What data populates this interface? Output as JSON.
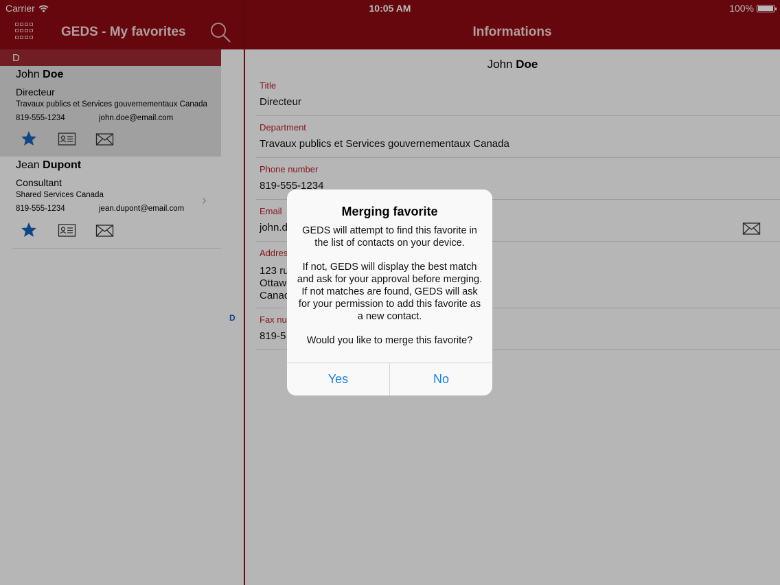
{
  "status_bar": {
    "carrier": "Carrier",
    "time": "10:05 AM",
    "battery": "100%"
  },
  "left_nav": {
    "title": "GEDS - My favorites",
    "section_letter": "D",
    "index_letter": "D"
  },
  "contacts": [
    {
      "first": "John ",
      "last": "Doe",
      "title": "Directeur",
      "department": "Travaux publics et Services gouvernementaux Canada",
      "phone": "819-555-1234",
      "email": "john.doe@email.com"
    },
    {
      "first": "Jean ",
      "last": "Dupont",
      "title": "Consultant",
      "department": "Shared Services Canada",
      "phone": "819-555-1234",
      "email": "jean.dupont@email.com"
    }
  ],
  "detail": {
    "header": "Informations",
    "first": "John ",
    "last": "Doe",
    "fields": [
      {
        "label": "Title",
        "value": "Directeur"
      },
      {
        "label": "Department",
        "value": "Travaux publics et Services gouvernementaux Canada"
      },
      {
        "label": "Phone number",
        "value": "819-555-1234"
      },
      {
        "label": "Email",
        "value": "john.d"
      },
      {
        "label": "Addres",
        "value": "123 ru\nOttaw\nCanac"
      },
      {
        "label": "Fax nu",
        "value": "819-5"
      }
    ]
  },
  "alert": {
    "title": "Merging favorite",
    "message": "GEDS will attempt to find this favorite in the list of contacts on your device.\n\nIf not, GEDS will display the best match and ask for your approval before merging. If not matches are found, GEDS will ask for your permission to add this favorite as a new contact.\n\nWould you like to merge this favorite?",
    "yes": "Yes",
    "no": "No"
  },
  "colors": {
    "brand": "#8b0a12",
    "label": "#b5202b",
    "star": "#1a5fb4",
    "link": "#1a7fd8"
  },
  "icons": [
    "wifi-icon",
    "battery-icon",
    "grid-menu-icon",
    "search-icon",
    "star-icon",
    "contact-card-icon",
    "mail-icon",
    "chevron-right-icon"
  ]
}
